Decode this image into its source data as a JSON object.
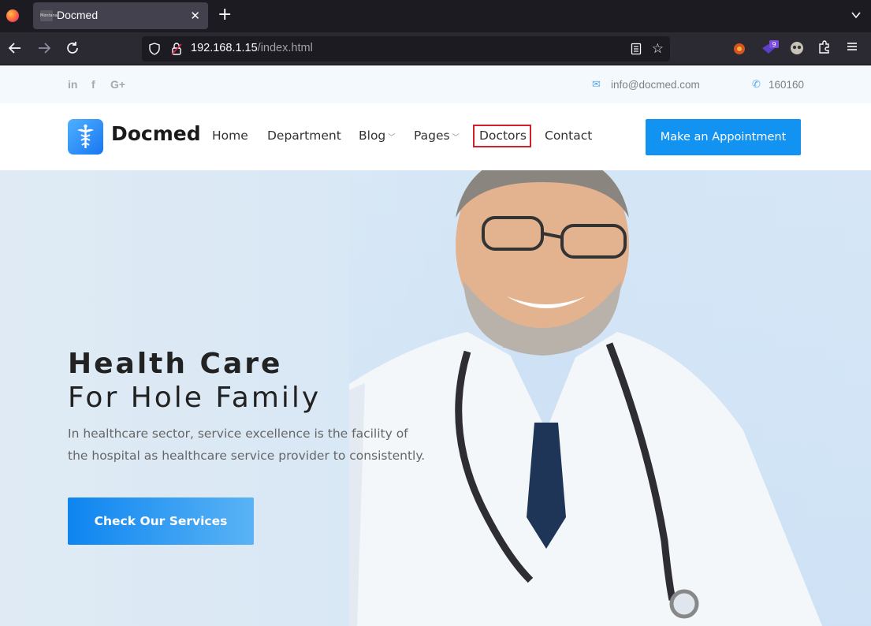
{
  "browser": {
    "tab_title": "Docmed",
    "tab_favicon_text": "Montana",
    "url_host": "192.168.1.15",
    "url_path": "/index.html",
    "extension_badge": "9"
  },
  "topbar": {
    "social": [
      "in",
      "f",
      "G+"
    ],
    "email": "info@docmed.com",
    "phone": "160160"
  },
  "header": {
    "logo_text": "Docmed",
    "menu": {
      "home": "Home",
      "department": "Department",
      "blog": "Blog",
      "pages": "Pages",
      "doctors": "Doctors",
      "contact": "Contact"
    },
    "cta": "Make an Appointment"
  },
  "hero": {
    "title_line1": "Health Care",
    "title_line2": "For Hole Family",
    "text_line1": "In healthcare sector, service excellence is the facility of",
    "text_line2": "the hospital as healthcare service provider to consistently.",
    "button": "Check Our Services"
  },
  "colors": {
    "accent": "#1393f1",
    "highlight_border": "#d21f2c"
  }
}
